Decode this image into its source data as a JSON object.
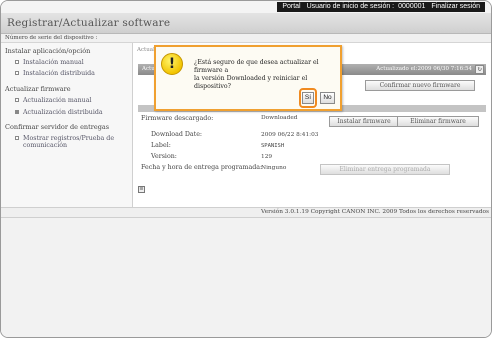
{
  "topbar": {
    "portal": "Portal",
    "user_label": "Usuario de inicio de sesión :",
    "user_id": "0000001",
    "logout": "Finalizar sesión"
  },
  "header": {
    "title": "Registrar/Actualizar software"
  },
  "device_line": "Número de serie del dispositivo :",
  "sidebar": {
    "sections": [
      {
        "label": "Instalar aplicación/opción",
        "items": [
          {
            "label": "Instalación manual"
          },
          {
            "label": "Instalación distribuida"
          }
        ]
      },
      {
        "label": "Actualizar firmware",
        "items": [
          {
            "label": "Actualización manual"
          },
          {
            "label": "Actualización distribuida"
          }
        ]
      },
      {
        "label": "Confirmar servidor de entregas",
        "items": [
          {
            "label": "Mostrar registros/Prueba de",
            "label2": "comunicación"
          }
        ]
      }
    ]
  },
  "main": {
    "breadcrumb": "Actualiz...",
    "bar1_left": "Actua...",
    "bar1_right": "Actualizado el:2009 06/30 7:16:54",
    "refresh_icon": "↻",
    "confirm_new_fw": "Confirmar nuevo firmware",
    "firmware_label": "Firmware descargado:",
    "firmware_value": "Downloaded",
    "install_fw": "Instalar firmware",
    "delete_fw": "Eliminar firmware",
    "download_date_label": "Download Date:",
    "download_date_value": "2009 06/22 8:41:03",
    "label_label": "Label:",
    "label_value": "SPANISH",
    "version_label": "Version:",
    "version_value": "129",
    "schedule_label": "Fecha y hora de entrega programada:",
    "schedule_value": "Ninguno",
    "delete_schedule": "Eliminar entrega programada"
  },
  "footer": {
    "copyright": "Versión 3.0.1.19 Copyright CANON INC. 2009 Todos los derechos reservados"
  },
  "dialog": {
    "icon": "!",
    "message_line1": "¿Está seguro de que desea actualizar el firmware a",
    "message_line2": "la versión Downloaded y reiniciar el dispositivo?",
    "yes": "Sí",
    "no": "No"
  },
  "colors": {
    "accent": "#f08a20",
    "header_bar": "#8a8a8a",
    "dialog_bg": "#fdfbf3"
  }
}
